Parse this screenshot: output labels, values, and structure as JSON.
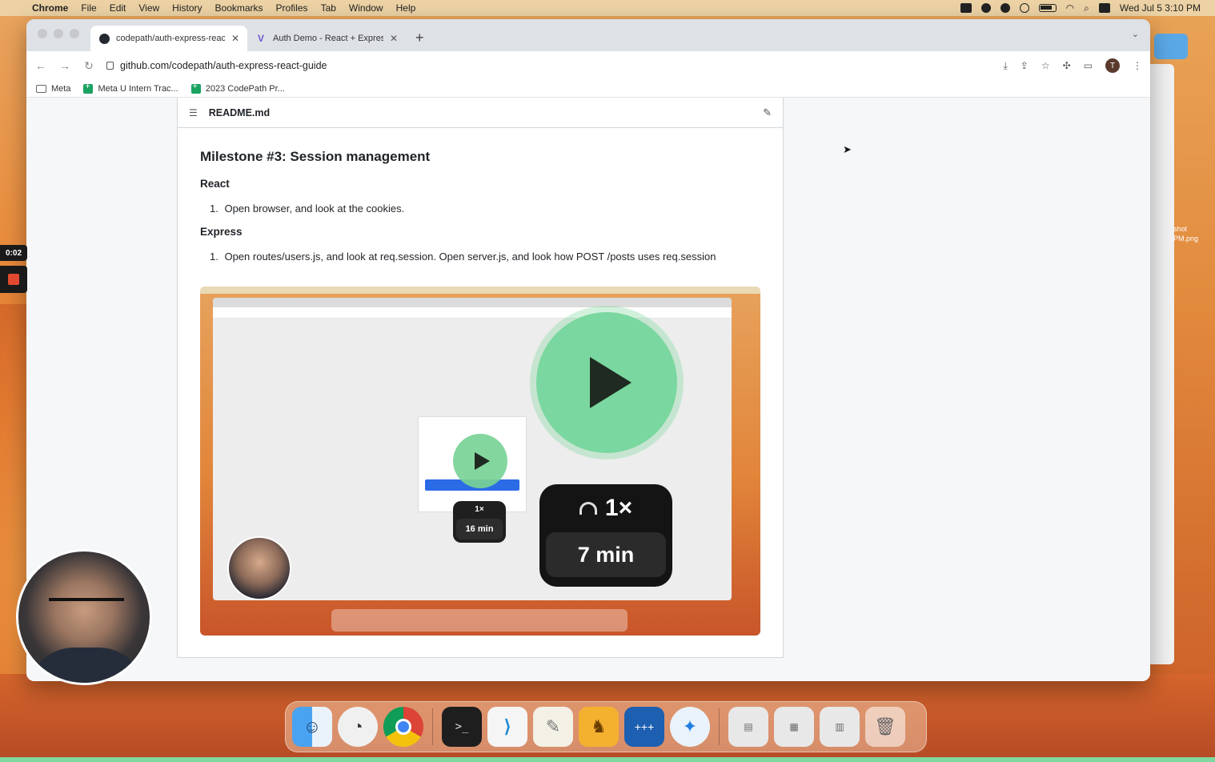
{
  "menubar": {
    "apple": "",
    "items": [
      "Chrome",
      "File",
      "Edit",
      "View",
      "History",
      "Bookmarks",
      "Profiles",
      "Tab",
      "Window",
      "Help"
    ],
    "clock": "Wed Jul 5  3:10 PM"
  },
  "browser": {
    "tabs": [
      {
        "title": "codepath/auth-express-react-",
        "favicon": "github-icon"
      },
      {
        "title": "Auth Demo - React + Express",
        "favicon": "vite-icon"
      }
    ],
    "new_tab": "+",
    "url": "github.com/codepath/auth-express-react-guide",
    "avatar_letter": "T",
    "bookmarks": [
      "Meta",
      "Meta U Intern Trac...",
      "2023 CodePath Pr..."
    ]
  },
  "readme": {
    "filename": "README.md",
    "heading": "Milestone #3: Session management",
    "section1": "React",
    "item1_num": "1.",
    "item1": "Open browser, and look at the cookies.",
    "section2": "Express",
    "item2_num": "1.",
    "item2": "Open routes/users.js, and look at req.session. Open server.js, and look how POST /posts uses req.session"
  },
  "video": {
    "inner_speed": "1×",
    "inner_duration": "16 min",
    "speed": "1×",
    "duration": "7 min"
  },
  "recording": {
    "timer": "0:02"
  },
  "side": {
    "file_label": "shot\nPM.png"
  },
  "dock": [
    "finder-icon",
    "activity-icon",
    "chrome-icon",
    "terminal-icon",
    "vscode-icon",
    "textedit-icon",
    "tableplus-icon",
    "calculator-icon",
    "safari-icon",
    "folder-icon",
    "document-icon",
    "document-icon",
    "trash-icon"
  ]
}
